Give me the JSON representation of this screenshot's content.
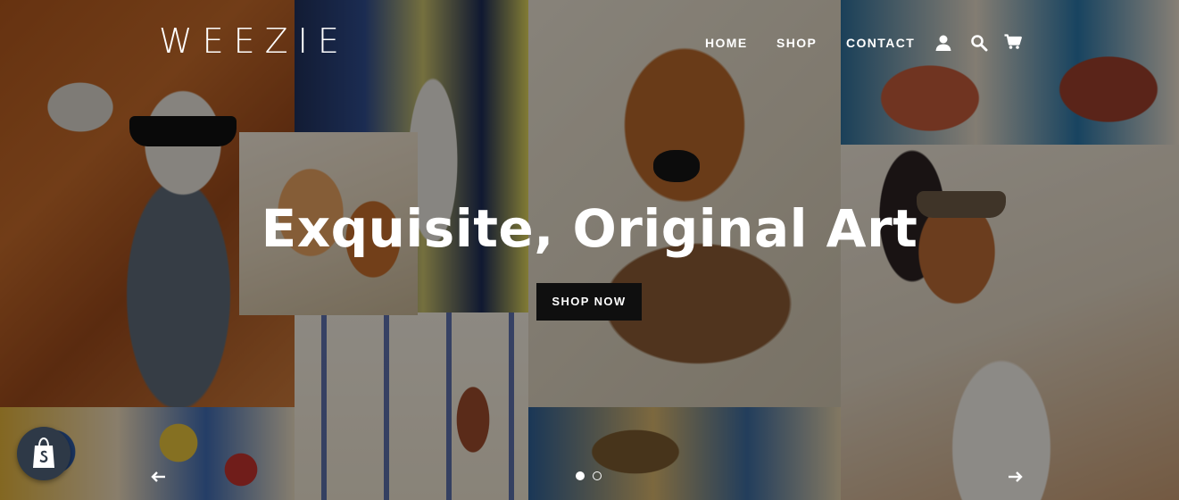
{
  "header": {
    "logo_text": "WEEZIE",
    "nav": {
      "home": "HOME",
      "shop": "SHOP",
      "contact": "CONTACT"
    },
    "icons": [
      "account-icon",
      "search-icon",
      "cart-icon"
    ]
  },
  "hero": {
    "headline": "Exquisite, Original Art",
    "cta_label": "SHOP NOW",
    "slides": {
      "count": 2,
      "active_index": 1
    }
  },
  "colors": {
    "text": "#ffffff",
    "button_bg": "#0f0f0f",
    "badge_bg": "#2e3947"
  },
  "badge": {
    "icon": "shopify-bag-icon"
  }
}
